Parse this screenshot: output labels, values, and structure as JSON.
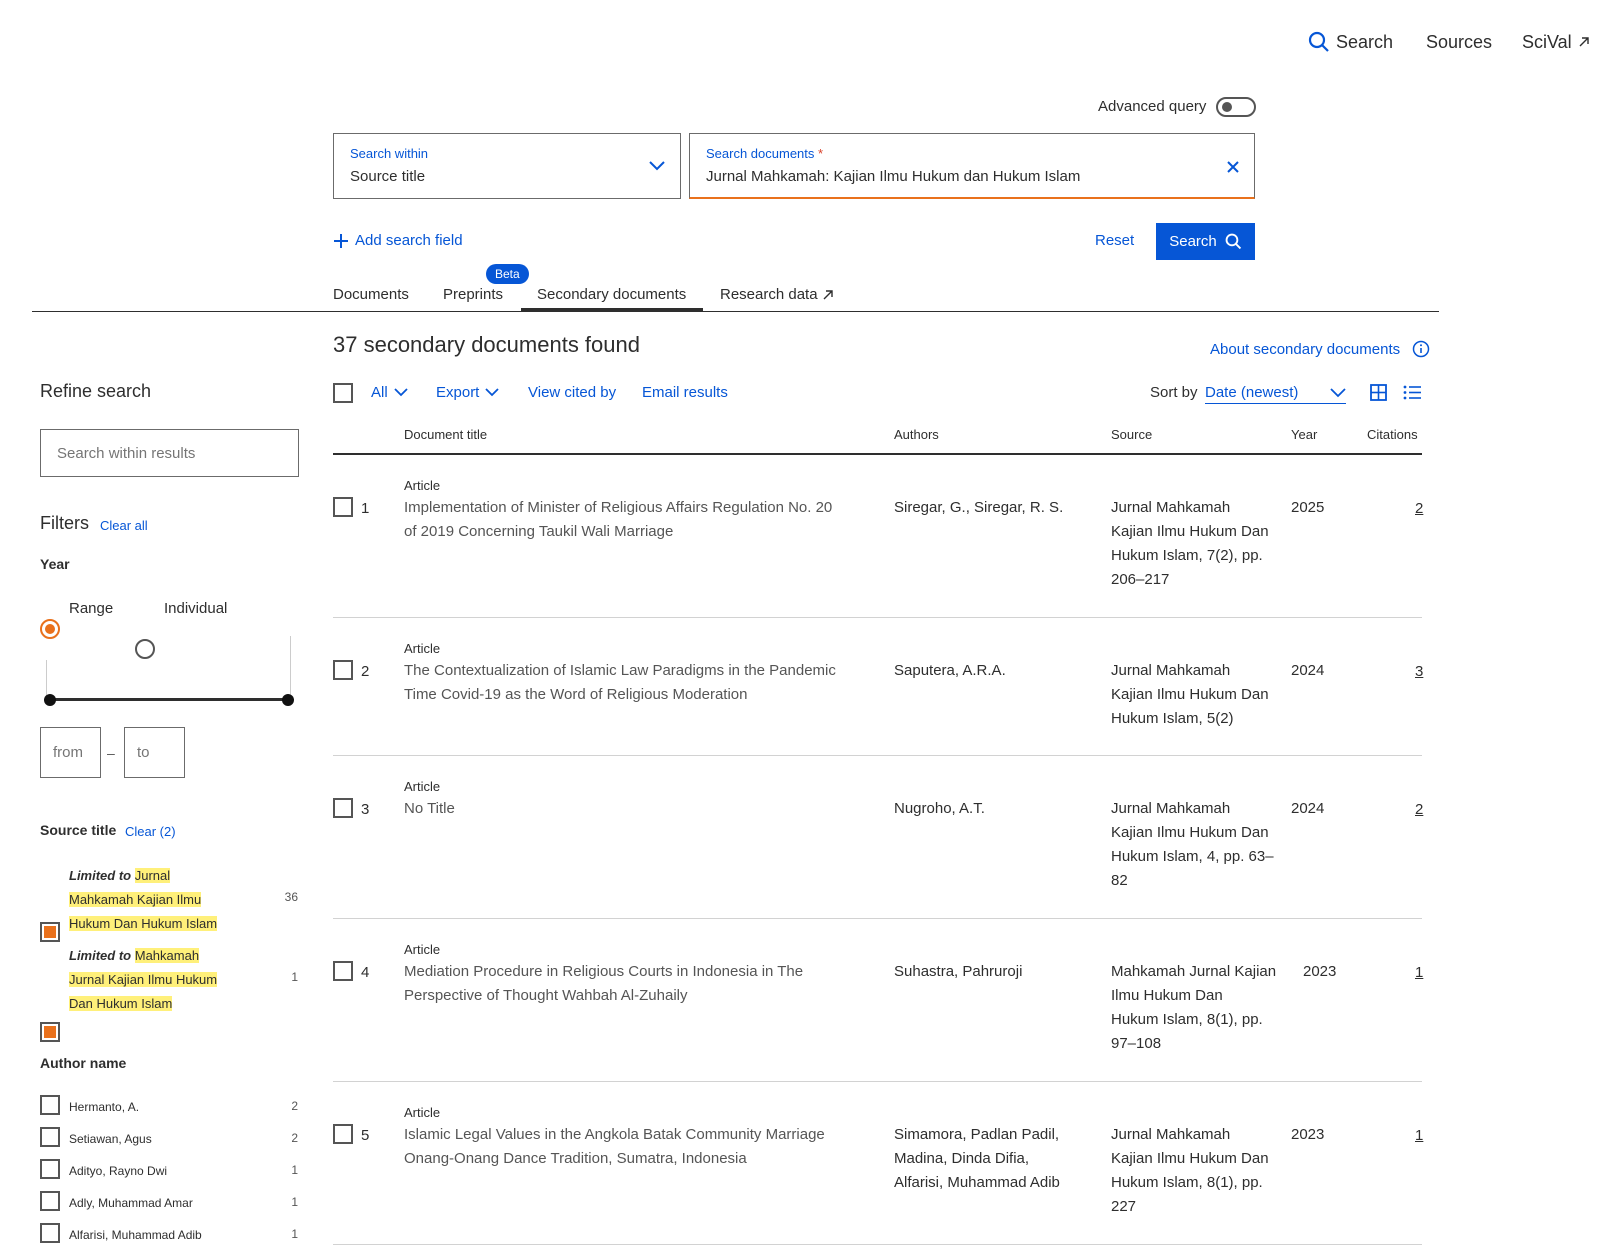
{
  "topnav": {
    "search": "Search",
    "sources": "Sources",
    "scival": "SciVal"
  },
  "search": {
    "advanced_query": "Advanced query",
    "within_label": "Search within",
    "within_value": "Source title",
    "documents_label": "Search documents",
    "required_mark": "*",
    "documents_value": "Jurnal Mahkamah: Kajian Ilmu Hukum dan Hukum Islam",
    "add_field": "Add search field",
    "reset": "Reset",
    "search_button": "Search"
  },
  "tabs": {
    "documents": "Documents",
    "preprints": "Preprints",
    "beta": "Beta",
    "secondary": "Secondary documents",
    "research_data": "Research data"
  },
  "sidebar": {
    "refine": "Refine search",
    "search_within_placeholder": "Search within results",
    "filters": "Filters",
    "clear_all": "Clear all",
    "year": "Year",
    "range": "Range",
    "individual": "Individual",
    "from": "from",
    "to": "to",
    "dash": "–",
    "source_title": "Source title",
    "source_clear": "Clear (2)",
    "sources": [
      {
        "prefix": "Limited to",
        "line1": "Jurnal",
        "line2": "Mahkamah Kajian Ilmu",
        "line3": "Hukum Dan Hukum Islam",
        "count": "36"
      },
      {
        "prefix": "Limited to",
        "line1": "Mahkamah",
        "line2": "Jurnal Kajian Ilmu Hukum",
        "line3": "Dan Hukum Islam",
        "count": "1"
      }
    ],
    "author_name": "Author name",
    "authors": [
      {
        "name": "Hermanto, A.",
        "count": "2"
      },
      {
        "name": "Setiawan, Agus",
        "count": "2"
      },
      {
        "name": "Adityo, Rayno Dwi",
        "count": "1"
      },
      {
        "name": "Adly, Muhammad Amar",
        "count": "1"
      },
      {
        "name": "Alfarisi, Muhammad Adib",
        "count": "1"
      }
    ]
  },
  "results": {
    "heading": "37 secondary documents found",
    "about": "About secondary documents",
    "all": "All",
    "export": "Export",
    "view_cited_by": "View cited by",
    "email_results": "Email results",
    "sort_by": "Sort by",
    "sort_value": "Date (newest)",
    "columns": {
      "title": "Document title",
      "authors": "Authors",
      "source": "Source",
      "year": "Year",
      "citations": "Citations"
    },
    "rows": [
      {
        "num": "1",
        "type": "Article",
        "title1": "Implementation of Minister of Religious Affairs Regulation No. 20",
        "title2": "of 2019 Concerning Taukil Wali Marriage",
        "authors1": "Siregar, G., Siregar, R. S.",
        "authors2": "",
        "authors3": "",
        "source1": "Jurnal Mahkamah",
        "source2": "Kajian Ilmu Hukum Dan",
        "source3": "Hukum Islam, 7(2), pp.",
        "source4": "206–217",
        "year": "2025",
        "citations": "2"
      },
      {
        "num": "2",
        "type": "Article",
        "title1": "The Contextualization of Islamic Law Paradigms in the Pandemic",
        "title2": "Time Covid-19 as the Word of Religious Moderation",
        "authors1": "Saputera, A.R.A.",
        "authors2": "",
        "authors3": "",
        "source1": "Jurnal Mahkamah",
        "source2": "Kajian Ilmu Hukum Dan",
        "source3": "Hukum Islam, 5(2)",
        "source4": "",
        "year": "2024",
        "citations": "3"
      },
      {
        "num": "3",
        "type": "Article",
        "title1": "No Title",
        "title2": "",
        "authors1": "Nugroho, A.T.",
        "authors2": "",
        "authors3": "",
        "source1": "Jurnal Mahkamah",
        "source2": "Kajian Ilmu Hukum Dan",
        "source3": "Hukum Islam, 4, pp. 63–",
        "source4": "82",
        "year": "2024",
        "citations": "2"
      },
      {
        "num": "4",
        "type": "Article",
        "title1": "Mediation Procedure in Religious Courts in Indonesia in The",
        "title2": "Perspective of Thought Wahbah Al-Zuhaily",
        "authors1": "Suhastra, Pahruroji",
        "authors2": "",
        "authors3": "",
        "source1": "Mahkamah Jurnal Kajian",
        "source2": "Ilmu Hukum Dan",
        "source3": "Hukum Islam, 8(1), pp.",
        "source4": "97–108",
        "year": "2023",
        "citations": "1"
      },
      {
        "num": "5",
        "type": "Article",
        "title1": "Islamic Legal Values in the Angkola Batak Community Marriage",
        "title2": "Onang-Onang Dance Tradition, Sumatra, Indonesia",
        "authors1": "Simamora, Padlan Padil,",
        "authors2": "Madina, Dinda Difia,",
        "authors3": "Alfarisi, Muhammad Adib",
        "source1": "Jurnal Mahkamah",
        "source2": "Kajian Ilmu Hukum Dan",
        "source3": "Hukum Islam, 8(1), pp.",
        "source4": "227",
        "year": "2023",
        "citations": "1"
      }
    ]
  }
}
